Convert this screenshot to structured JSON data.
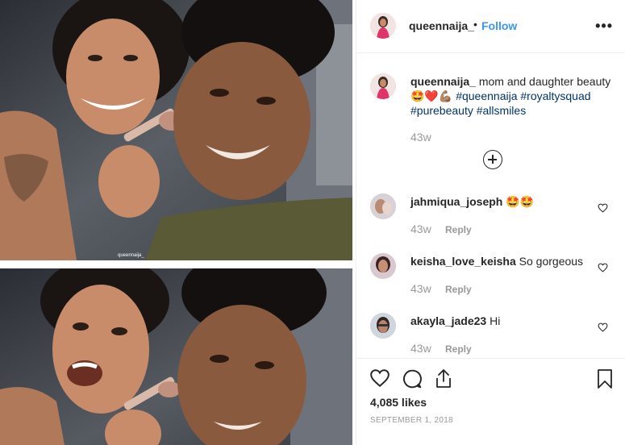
{
  "post": {
    "username": "queennaija_",
    "follow_label": "Follow",
    "dot": "•",
    "more_label": "•••",
    "watermark": "queennaija_"
  },
  "caption": {
    "username": "queennaija_",
    "text": "mom and daughter beauty",
    "emojis": "🤩❤️💪🏽",
    "tags": [
      "#queennaija",
      "#royaltysquad",
      "#purebeauty",
      "#allsmiles"
    ],
    "time": "43w"
  },
  "comments": [
    {
      "username": "jahmiqua_joseph",
      "text": "🤩🤩",
      "time": "43w",
      "reply_label": "Reply"
    },
    {
      "username": "keisha_love_keisha",
      "text": "So gorgeous",
      "time": "43w",
      "reply_label": "Reply"
    },
    {
      "username": "akayla_jade23",
      "text": "Hi",
      "time": "43w",
      "reply_label": "Reply"
    }
  ],
  "footer": {
    "likes": "4,085 likes",
    "date": "SEPTEMBER 1, 2018"
  },
  "icons": {
    "like": "heart-icon",
    "comment": "comment-icon",
    "share": "share-icon",
    "save": "bookmark-icon",
    "load_more": "plus-circle-icon",
    "more": "more-options-icon"
  },
  "colors": {
    "follow": "#3897f0",
    "hashtag": "#003569",
    "muted": "#999999",
    "border": "#efefef"
  }
}
